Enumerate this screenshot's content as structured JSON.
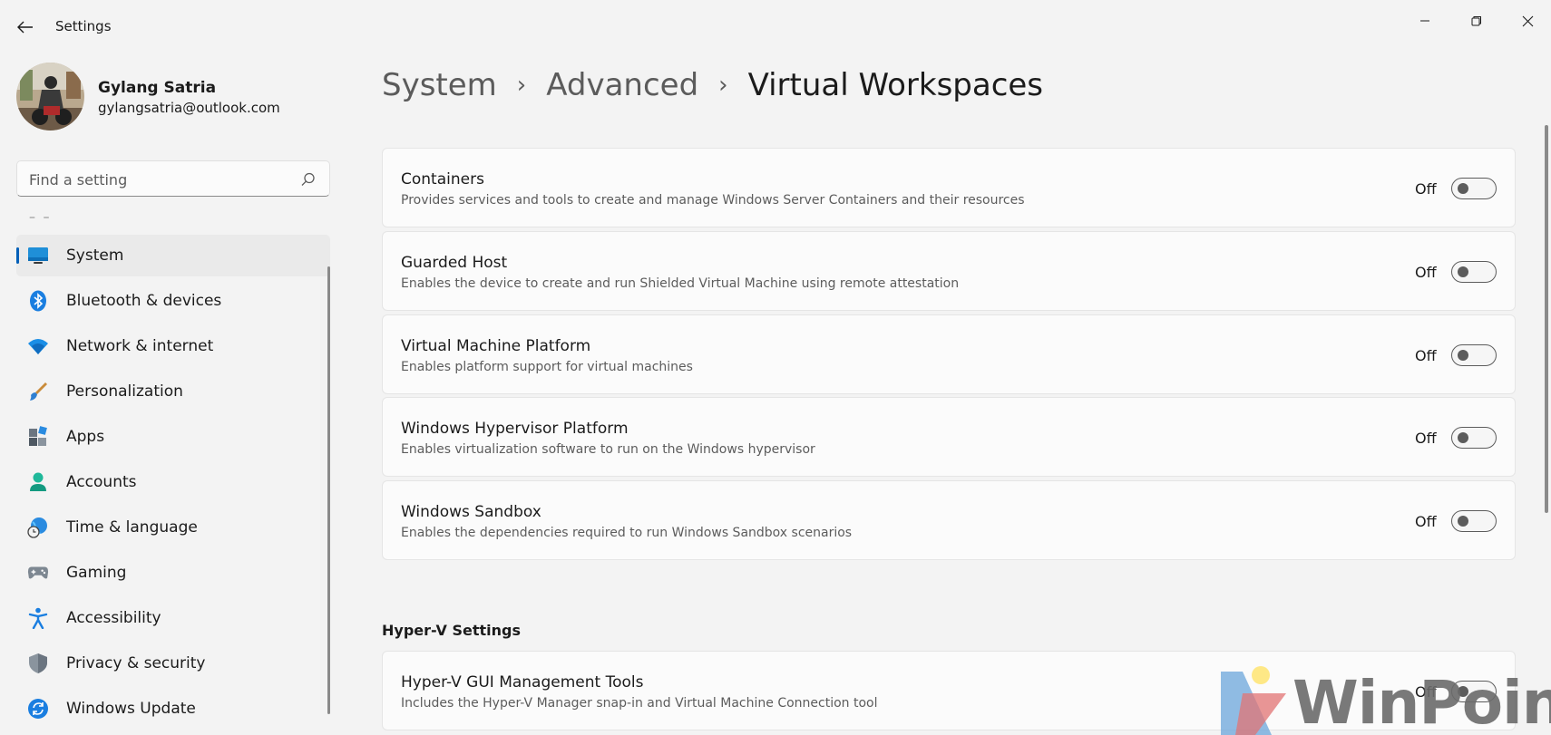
{
  "window": {
    "title": "Settings"
  },
  "profile": {
    "name": "Gylang Satria",
    "email": "gylangsatria@outlook.com"
  },
  "search": {
    "placeholder": "Find a setting"
  },
  "nav": {
    "items": [
      {
        "label": "System",
        "icon": "system-icon",
        "active": true
      },
      {
        "label": "Bluetooth & devices",
        "icon": "bluetooth-icon"
      },
      {
        "label": "Network & internet",
        "icon": "wifi-icon"
      },
      {
        "label": "Personalization",
        "icon": "brush-icon"
      },
      {
        "label": "Apps",
        "icon": "apps-icon"
      },
      {
        "label": "Accounts",
        "icon": "accounts-icon"
      },
      {
        "label": "Time & language",
        "icon": "globe-clock-icon"
      },
      {
        "label": "Gaming",
        "icon": "gamepad-icon"
      },
      {
        "label": "Accessibility",
        "icon": "accessibility-icon"
      },
      {
        "label": "Privacy & security",
        "icon": "shield-icon"
      },
      {
        "label": "Windows Update",
        "icon": "update-icon"
      }
    ]
  },
  "breadcrumb": {
    "items": [
      "System",
      "Advanced",
      "Virtual Workspaces"
    ]
  },
  "features": [
    {
      "title": "Containers",
      "description": "Provides services and tools to create and manage Windows Server Containers and their resources",
      "state": "Off"
    },
    {
      "title": "Guarded Host",
      "description": "Enables the device to create and run Shielded Virtual Machine using remote attestation",
      "state": "Off"
    },
    {
      "title": "Virtual Machine Platform",
      "description": "Enables platform support for virtual machines",
      "state": "Off"
    },
    {
      "title": "Windows Hypervisor Platform",
      "description": "Enables virtualization software to run on the Windows hypervisor",
      "state": "Off"
    },
    {
      "title": "Windows Sandbox",
      "description": "Enables the dependencies required to run Windows Sandbox scenarios",
      "state": "Off"
    }
  ],
  "hyperv": {
    "section_title": "Hyper-V Settings",
    "items": [
      {
        "title": "Hyper-V GUI Management Tools",
        "description": "Includes the Hyper-V Manager snap-in and Virtual Machine Connection tool",
        "state": "Off"
      }
    ]
  },
  "watermark": {
    "text": "WinPoin"
  },
  "colors": {
    "accent": "#005fb8",
    "background": "#f3f3f3",
    "card": "#fbfbfb"
  }
}
